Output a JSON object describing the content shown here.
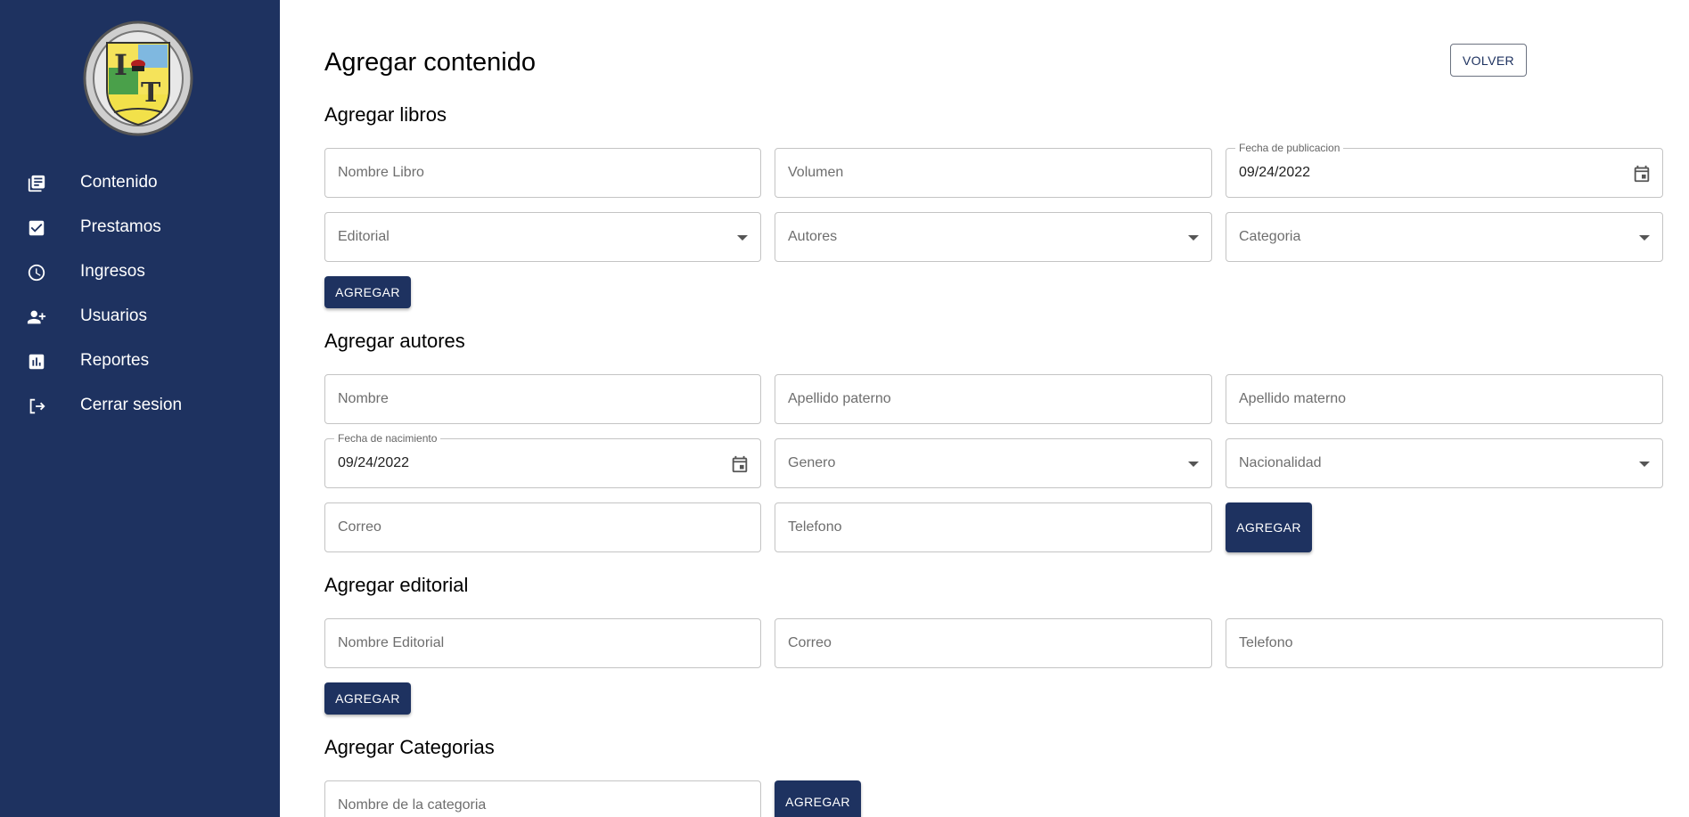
{
  "sidebar": {
    "logo_icon": "institution-crest-icon",
    "items": [
      {
        "label": "Contenido",
        "icon": "library-books-icon"
      },
      {
        "label": "Prestamos",
        "icon": "check-box-icon"
      },
      {
        "label": "Ingresos",
        "icon": "clock-icon"
      },
      {
        "label": "Usuarios",
        "icon": "person-add-icon"
      },
      {
        "label": "Reportes",
        "icon": "bar-chart-icon"
      },
      {
        "label": "Cerrar sesion",
        "icon": "logout-icon"
      }
    ]
  },
  "main": {
    "title": "Agregar contenido",
    "back_label": "VOLVER",
    "libros": {
      "title": "Agregar libros",
      "nombre_placeholder": "Nombre Libro",
      "volumen_placeholder": "Volumen",
      "fecha_label": "Fecha de publicacion",
      "fecha_value": "09/24/2022",
      "editorial_placeholder": "Editorial",
      "autores_placeholder": "Autores",
      "categoria_placeholder": "Categoria",
      "submit_label": "AGREGAR"
    },
    "autores": {
      "title": "Agregar autores",
      "nombre_placeholder": "Nombre",
      "apellido_paterno_placeholder": "Apellido paterno",
      "apellido_materno_placeholder": "Apellido materno",
      "fecha_label": "Fecha de nacimiento",
      "fecha_value": "09/24/2022",
      "genero_placeholder": "Genero",
      "nacionalidad_placeholder": "Nacionalidad",
      "correo_placeholder": "Correo",
      "telefono_placeholder": "Telefono",
      "submit_label": "AGREGAR"
    },
    "editorial": {
      "title": "Agregar editorial",
      "nombre_placeholder": "Nombre Editorial",
      "correo_placeholder": "Correo",
      "telefono_placeholder": "Telefono",
      "submit_label": "AGREGAR"
    },
    "categorias": {
      "title": "Agregar Categorias",
      "nombre_placeholder": "Nombre de la categoria",
      "submit_label": "AGREGAR"
    }
  },
  "colors": {
    "sidebar_bg": "#1e3260",
    "primary": "#1e3260",
    "field_border": "#c4c4c4",
    "background": "#ffffff"
  }
}
